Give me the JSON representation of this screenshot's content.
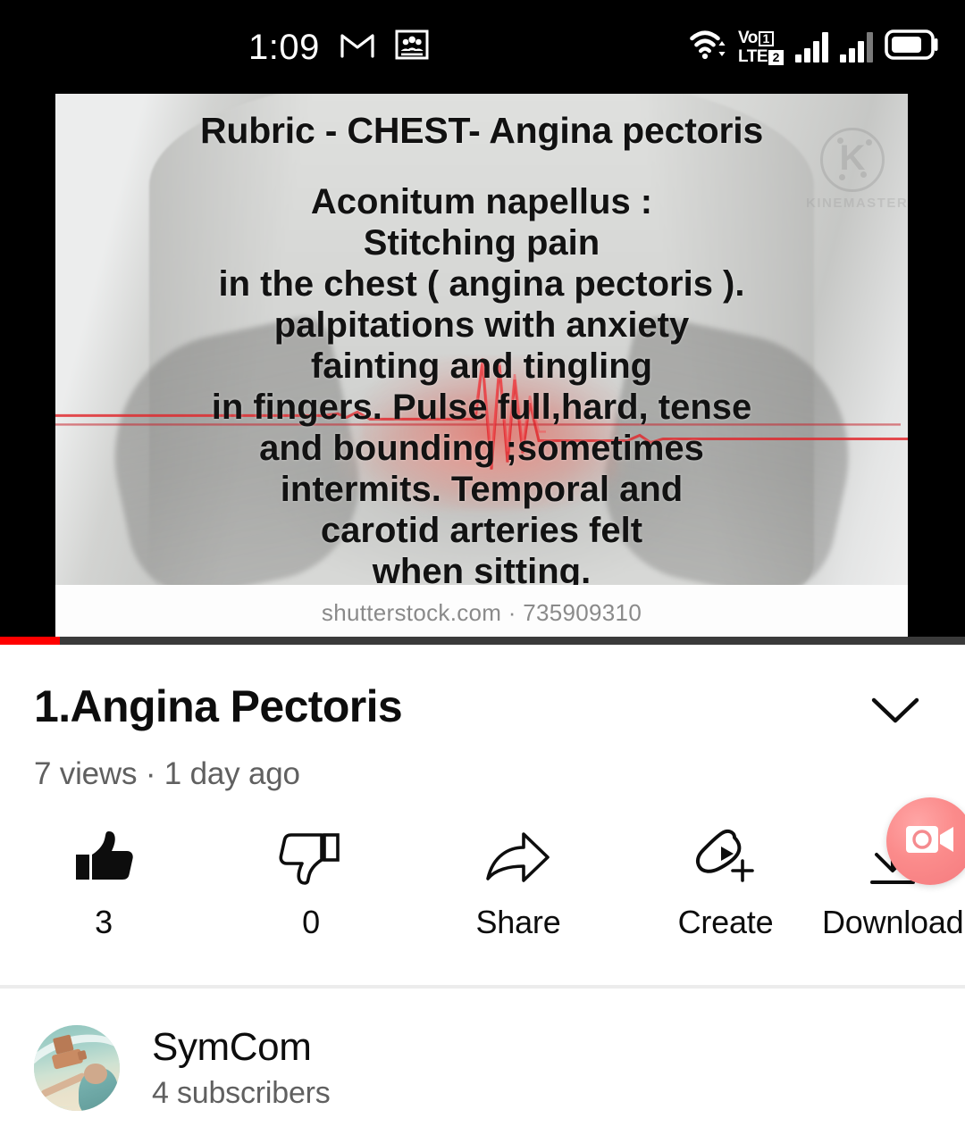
{
  "status_bar": {
    "clock": "1:09",
    "icons": [
      "gmail-icon",
      "people-card-icon",
      "wifi-icon",
      "volte-icon",
      "signal-sim1-icon",
      "signal-sim2-icon",
      "battery-icon"
    ],
    "volte_label_top": "Vo",
    "volte_label_bottom": "LTE",
    "volte_sim1_badge": "1",
    "volte_sim2_badge": "2"
  },
  "player": {
    "watermark": {
      "logo_letter": "K",
      "brand": "KINEMASTER"
    },
    "overlay": {
      "heading": "Rubric - CHEST- Angina pectoris",
      "lines": [
        "Aconitum napellus :",
        "Stitching pain",
        "in the chest ( angina pectoris ).",
        "palpitations with anxiety",
        "fainting and tingling",
        "in fingers. Pulse full,hard, tense",
        "and bounding ;sometimes",
        "intermits. Temporal and",
        "carotid arteries felt",
        "when sitting."
      ]
    },
    "credit": "shutterstock.com · 735909310",
    "progress_color": "#ff0000",
    "progress_percent": 6
  },
  "video": {
    "title": "1.Angina Pectoris",
    "stats": "7 views · 1 day ago",
    "expand_icon": "chevron-down-icon"
  },
  "actions": [
    {
      "icon": "thumbs-up-icon",
      "label": "3",
      "name": "like-button",
      "state": "active"
    },
    {
      "icon": "thumbs-down-icon",
      "label": "0",
      "name": "dislike-button",
      "state": "inactive"
    },
    {
      "icon": "share-icon",
      "label": "Share",
      "name": "share-button",
      "state": "inactive"
    },
    {
      "icon": "create-icon",
      "label": "Create",
      "name": "create-button",
      "state": "inactive"
    },
    {
      "icon": "download-icon",
      "label": "Download",
      "name": "download-button",
      "state": "inactive"
    }
  ],
  "floating_button": {
    "icon": "video-camera-icon",
    "color": "#f7868a"
  },
  "channel": {
    "name": "SymCom",
    "subscribers": "4 subscribers",
    "avatar": "channel-avatar"
  }
}
